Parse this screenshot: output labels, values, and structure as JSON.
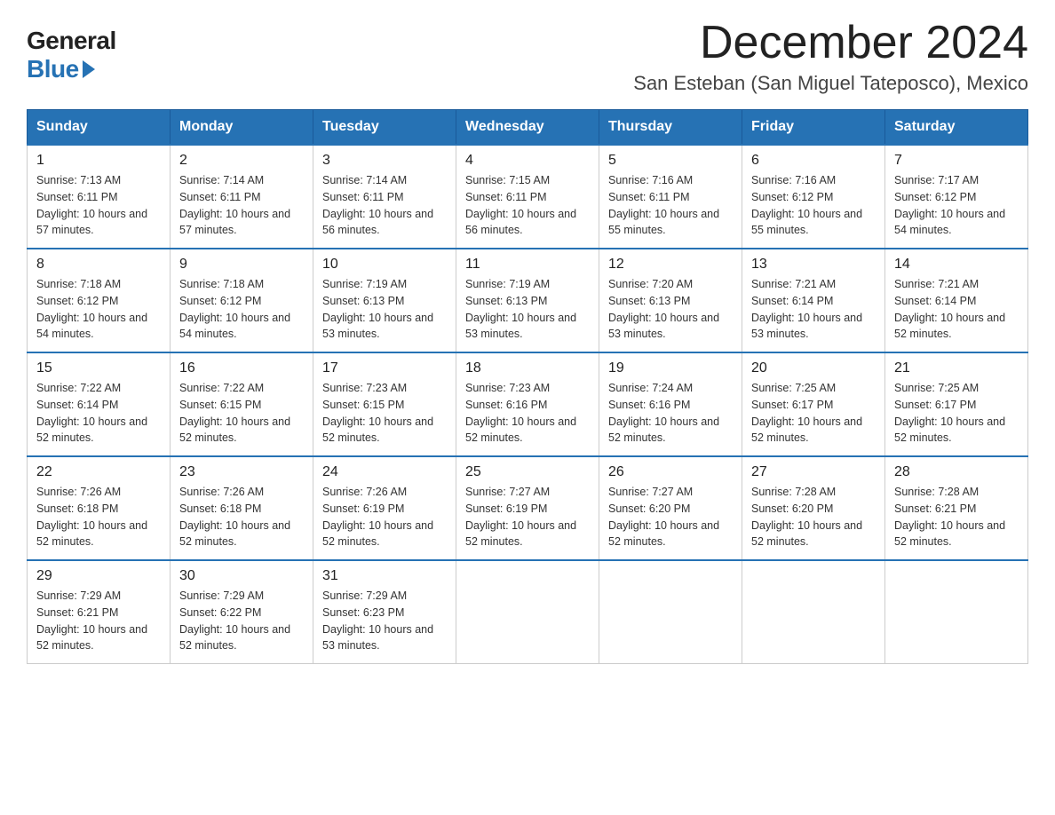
{
  "logo": {
    "general": "General",
    "blue": "Blue"
  },
  "title": "December 2024",
  "subtitle": "San Esteban (San Miguel Tateposco), Mexico",
  "days_of_week": [
    "Sunday",
    "Monday",
    "Tuesday",
    "Wednesday",
    "Thursday",
    "Friday",
    "Saturday"
  ],
  "weeks": [
    [
      {
        "day": "1",
        "sunrise": "7:13 AM",
        "sunset": "6:11 PM",
        "daylight": "10 hours and 57 minutes."
      },
      {
        "day": "2",
        "sunrise": "7:14 AM",
        "sunset": "6:11 PM",
        "daylight": "10 hours and 57 minutes."
      },
      {
        "day": "3",
        "sunrise": "7:14 AM",
        "sunset": "6:11 PM",
        "daylight": "10 hours and 56 minutes."
      },
      {
        "day": "4",
        "sunrise": "7:15 AM",
        "sunset": "6:11 PM",
        "daylight": "10 hours and 56 minutes."
      },
      {
        "day": "5",
        "sunrise": "7:16 AM",
        "sunset": "6:11 PM",
        "daylight": "10 hours and 55 minutes."
      },
      {
        "day": "6",
        "sunrise": "7:16 AM",
        "sunset": "6:12 PM",
        "daylight": "10 hours and 55 minutes."
      },
      {
        "day": "7",
        "sunrise": "7:17 AM",
        "sunset": "6:12 PM",
        "daylight": "10 hours and 54 minutes."
      }
    ],
    [
      {
        "day": "8",
        "sunrise": "7:18 AM",
        "sunset": "6:12 PM",
        "daylight": "10 hours and 54 minutes."
      },
      {
        "day": "9",
        "sunrise": "7:18 AM",
        "sunset": "6:12 PM",
        "daylight": "10 hours and 54 minutes."
      },
      {
        "day": "10",
        "sunrise": "7:19 AM",
        "sunset": "6:13 PM",
        "daylight": "10 hours and 53 minutes."
      },
      {
        "day": "11",
        "sunrise": "7:19 AM",
        "sunset": "6:13 PM",
        "daylight": "10 hours and 53 minutes."
      },
      {
        "day": "12",
        "sunrise": "7:20 AM",
        "sunset": "6:13 PM",
        "daylight": "10 hours and 53 minutes."
      },
      {
        "day": "13",
        "sunrise": "7:21 AM",
        "sunset": "6:14 PM",
        "daylight": "10 hours and 53 minutes."
      },
      {
        "day": "14",
        "sunrise": "7:21 AM",
        "sunset": "6:14 PM",
        "daylight": "10 hours and 52 minutes."
      }
    ],
    [
      {
        "day": "15",
        "sunrise": "7:22 AM",
        "sunset": "6:14 PM",
        "daylight": "10 hours and 52 minutes."
      },
      {
        "day": "16",
        "sunrise": "7:22 AM",
        "sunset": "6:15 PM",
        "daylight": "10 hours and 52 minutes."
      },
      {
        "day": "17",
        "sunrise": "7:23 AM",
        "sunset": "6:15 PM",
        "daylight": "10 hours and 52 minutes."
      },
      {
        "day": "18",
        "sunrise": "7:23 AM",
        "sunset": "6:16 PM",
        "daylight": "10 hours and 52 minutes."
      },
      {
        "day": "19",
        "sunrise": "7:24 AM",
        "sunset": "6:16 PM",
        "daylight": "10 hours and 52 minutes."
      },
      {
        "day": "20",
        "sunrise": "7:25 AM",
        "sunset": "6:17 PM",
        "daylight": "10 hours and 52 minutes."
      },
      {
        "day": "21",
        "sunrise": "7:25 AM",
        "sunset": "6:17 PM",
        "daylight": "10 hours and 52 minutes."
      }
    ],
    [
      {
        "day": "22",
        "sunrise": "7:26 AM",
        "sunset": "6:18 PM",
        "daylight": "10 hours and 52 minutes."
      },
      {
        "day": "23",
        "sunrise": "7:26 AM",
        "sunset": "6:18 PM",
        "daylight": "10 hours and 52 minutes."
      },
      {
        "day": "24",
        "sunrise": "7:26 AM",
        "sunset": "6:19 PM",
        "daylight": "10 hours and 52 minutes."
      },
      {
        "day": "25",
        "sunrise": "7:27 AM",
        "sunset": "6:19 PM",
        "daylight": "10 hours and 52 minutes."
      },
      {
        "day": "26",
        "sunrise": "7:27 AM",
        "sunset": "6:20 PM",
        "daylight": "10 hours and 52 minutes."
      },
      {
        "day": "27",
        "sunrise": "7:28 AM",
        "sunset": "6:20 PM",
        "daylight": "10 hours and 52 minutes."
      },
      {
        "day": "28",
        "sunrise": "7:28 AM",
        "sunset": "6:21 PM",
        "daylight": "10 hours and 52 minutes."
      }
    ],
    [
      {
        "day": "29",
        "sunrise": "7:29 AM",
        "sunset": "6:21 PM",
        "daylight": "10 hours and 52 minutes."
      },
      {
        "day": "30",
        "sunrise": "7:29 AM",
        "sunset": "6:22 PM",
        "daylight": "10 hours and 52 minutes."
      },
      {
        "day": "31",
        "sunrise": "7:29 AM",
        "sunset": "6:23 PM",
        "daylight": "10 hours and 53 minutes."
      },
      null,
      null,
      null,
      null
    ]
  ]
}
